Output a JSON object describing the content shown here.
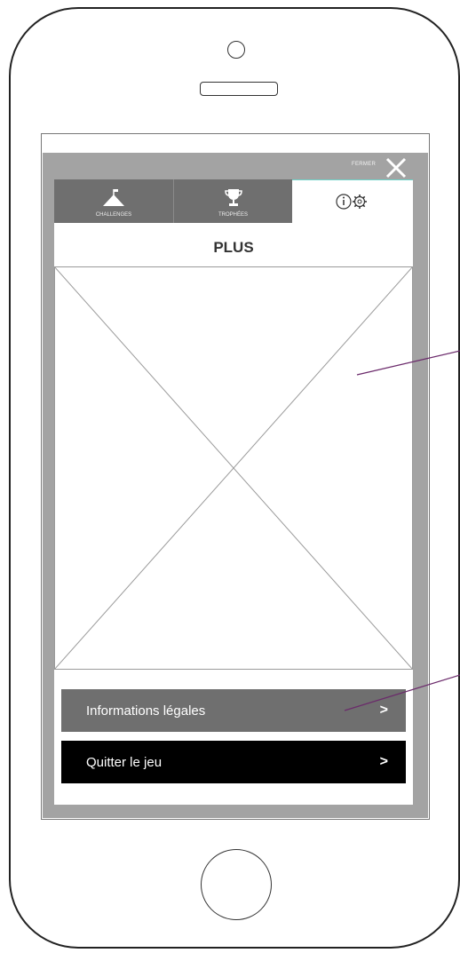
{
  "header": {
    "close_label": "FERMER"
  },
  "tabs": [
    {
      "label": "CHALLENGES",
      "icon": "mountain-flag-icon",
      "active": false
    },
    {
      "label": "TROPHÉES",
      "icon": "trophy-icon",
      "active": false
    },
    {
      "label": "",
      "icon": "info-gear-icon",
      "active": true
    }
  ],
  "page": {
    "title": "PLUS",
    "image_placeholder": "image-placeholder"
  },
  "menu": [
    {
      "label": "Informations légales",
      "chevron": ">"
    },
    {
      "label": "Quitter le jeu",
      "chevron": ">"
    }
  ],
  "colors": {
    "frame": "#a3a3a3",
    "tab_inactive": "#6f6f6f",
    "button_legal": "#6f6f6f",
    "button_quit": "#000000",
    "annotation_line": "#6b2a6b"
  }
}
